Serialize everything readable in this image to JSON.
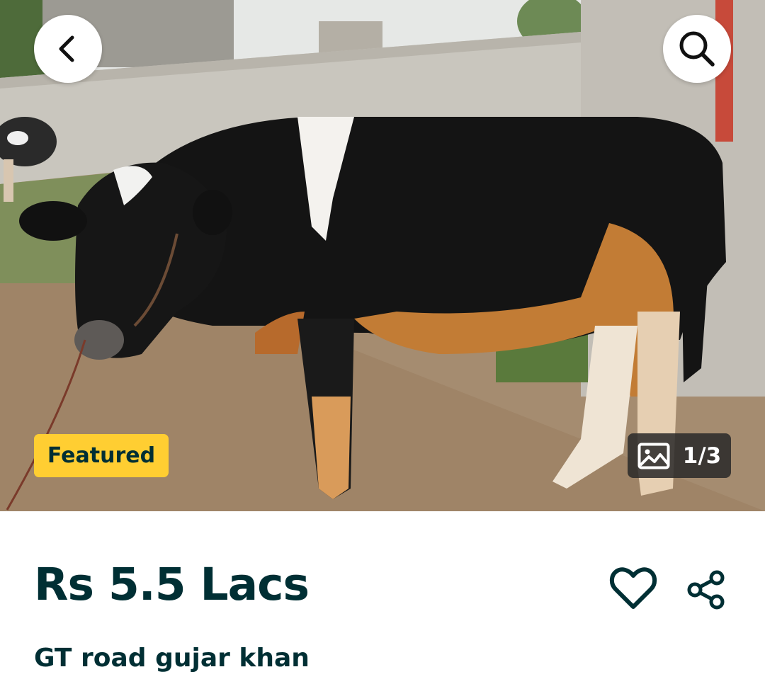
{
  "listing": {
    "badge": "Featured",
    "image_counter": "1/3",
    "price": "Rs 5.5 Lacs",
    "location": "GT road gujar khan"
  },
  "icons": {
    "back": "chevron-left-icon",
    "search": "search-icon",
    "gallery": "image-icon",
    "favorite": "heart-icon",
    "share": "share-icon"
  },
  "colors": {
    "primary_text": "#002f34",
    "featured_badge": "#ffce32",
    "counter_bg": "#282828",
    "button_bg": "#ffffff"
  }
}
